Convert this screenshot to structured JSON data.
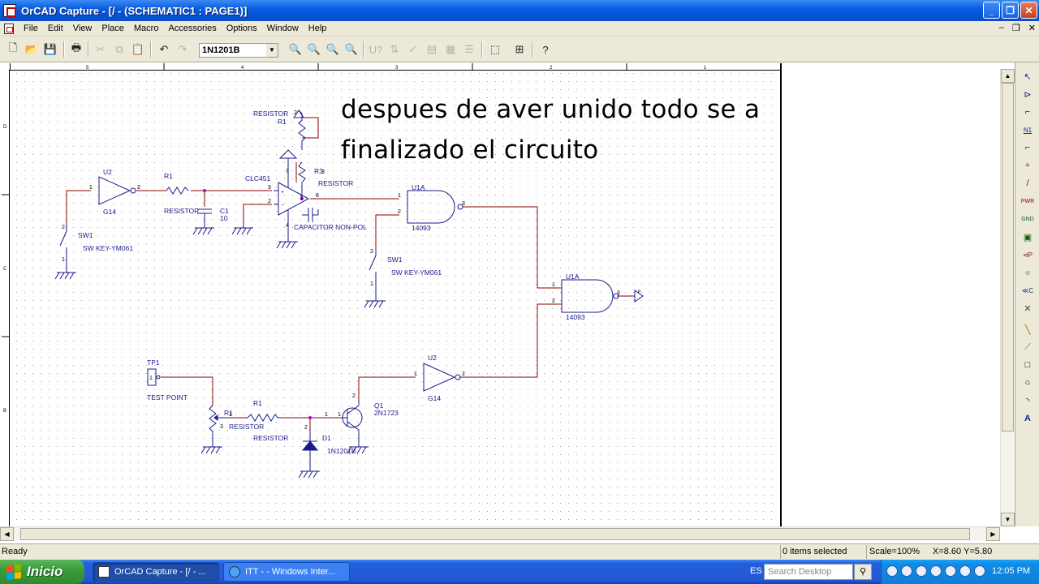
{
  "window": {
    "title": "OrCAD Capture - [/ - (SCHEMATIC1 : PAGE1)]",
    "min": "_",
    "max": "❐",
    "close": "✕"
  },
  "menu": [
    "File",
    "Edit",
    "View",
    "Place",
    "Macro",
    "Accessories",
    "Options",
    "Window",
    "Help"
  ],
  "mdi": {
    "min": "–",
    "restore": "❐",
    "close": "✕"
  },
  "toolbar": {
    "part_selector": "1N1201B",
    "buttons": [
      "new-icon",
      "open-icon",
      "save-icon",
      "print-icon",
      "cut-icon",
      "copy-icon",
      "paste-icon",
      "undo-icon",
      "redo-icon",
      "zoom-in-icon",
      "zoom-out-icon",
      "zoom-area-icon",
      "zoom-all-icon",
      "annotate-icon",
      "back-annotate-icon",
      "drc-icon",
      "netlist-icon",
      "cross-ref-icon",
      "bom-icon",
      "snap-grid-icon",
      "project-manager-icon",
      "help-icon"
    ]
  },
  "ruler": {
    "top": [
      "5",
      "4",
      "3",
      "2",
      "1"
    ],
    "left": [
      "D",
      "C",
      "B"
    ]
  },
  "note": {
    "line1": "despues de aver unido todo se a",
    "line2": "finalizado el circuito"
  },
  "schematic": {
    "u2_top": {
      "ref": "U2",
      "value": "G14",
      "pin_in": "1",
      "pin_out": "2"
    },
    "r1_top": {
      "ref": "R1",
      "value": "RESISTOR"
    },
    "c1": {
      "ref": "C1",
      "value": "10"
    },
    "sw1_left": {
      "ref": "SW1",
      "value": "SW KEY-YM061",
      "pin_a": "2",
      "pin_b": "1"
    },
    "opamp": {
      "ref": "CLC451",
      "pin_plus": "3",
      "pin_minus": "2",
      "pin_vplus": "7",
      "pin_vminus": "4",
      "pin_out": "6",
      "pin_extra": "1"
    },
    "pot_top": {
      "ref": "R1",
      "value": "RESISTOR",
      "pin": "2"
    },
    "r3": {
      "ref": "R3",
      "pin": "3",
      "value": "RESISTOR"
    },
    "cap_np": {
      "value": "CAPACITOR NON-POL"
    },
    "u1a_top": {
      "ref": "U1A",
      "value": "14093",
      "pin_a": "1",
      "pin_b": "2",
      "pin_out": "3"
    },
    "sw1_mid": {
      "ref": "SW1",
      "value": "SW KEY-YM061",
      "pin_a": "2",
      "pin_b": "1"
    },
    "u1a_right": {
      "ref": "U1A",
      "value": "14093",
      "pin_a": "1",
      "pin_b": "2",
      "pin_out": "3",
      "offpage": "F"
    },
    "tp1": {
      "ref": "TP1",
      "value": "TEST POINT",
      "pin": "1"
    },
    "pot_bottom": {
      "ref": "R1",
      "pin_top": "1",
      "pin_bottom": "3",
      "value": "RESISTOR"
    },
    "r1_bottom": {
      "ref": "R1",
      "value": "RESISTOR",
      "pin": "1"
    },
    "q1": {
      "ref": "Q1",
      "value": "2N1723",
      "pin_c": "2",
      "pin_b": "1"
    },
    "d1": {
      "ref": "D1",
      "value": "1N1201B",
      "pin": "2"
    },
    "u2_bottom": {
      "ref": "U2",
      "value": "G14",
      "pin_in": "1",
      "pin_out": "2"
    }
  },
  "palette": [
    "select-icon",
    "place-part-icon",
    "place-wire-icon",
    "place-net-alias-icon",
    "place-bus-icon",
    "place-junction-icon",
    "place-bus-entry-icon",
    "place-power-icon",
    "place-ground-icon",
    "place-hierarchical-block-icon",
    "place-port-icon",
    "place-pin-icon",
    "place-offpage-connector-icon",
    "place-no-connect-icon",
    "place-line-icon",
    "place-polyline-icon",
    "place-rectangle-icon",
    "place-ellipse-icon",
    "place-arc-icon",
    "place-text-icon"
  ],
  "palette_labels": {
    "n1": "N1",
    "pwr": "PWR",
    "gnd": "GND",
    "a": "A"
  },
  "status": {
    "ready": "Ready",
    "selection": "0 items selected",
    "scale": "Scale=100%",
    "coords": "X=8.60  Y=5.80"
  },
  "taskbar": {
    "start": "Inicio",
    "items": [
      "OrCAD Capture - [/ - ...",
      "ITT - - Windows Inter..."
    ],
    "lang": "ES",
    "search_placeholder": "Search Desktop",
    "clock": "12:05 PM"
  },
  "colors": {
    "wire": "#8b0000",
    "component": "#1a1a8c",
    "pin": "#8b0000",
    "title_bar": "#0a5ee0",
    "xp_green": "#3a9b3a"
  }
}
